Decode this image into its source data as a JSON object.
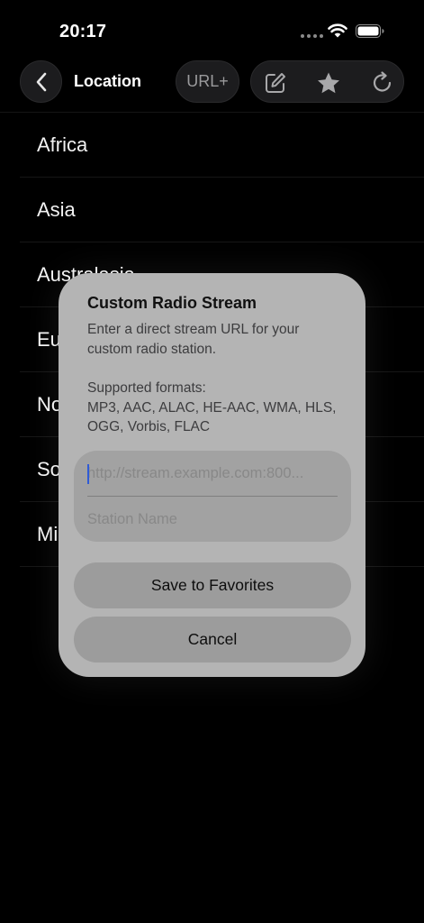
{
  "status_bar": {
    "time": "20:17"
  },
  "nav": {
    "title": "Location",
    "url_button_label": "URL+"
  },
  "regions": [
    "Africa",
    "Asia",
    "Australasia",
    "Europe",
    "North America",
    "South America",
    "Middle East"
  ],
  "dialog": {
    "title": "Custom Radio Stream",
    "message": "Enter a direct stream URL for your custom radio station.",
    "formats_heading": "Supported formats:",
    "formats_list": "MP3, AAC, ALAC, HE-AAC, WMA, HLS, OGG, Vorbis, FLAC",
    "url_placeholder": "http://stream.example.com:800...",
    "url_value": "",
    "name_placeholder": "Station Name",
    "name_value": "",
    "save_label": "Save to Favorites",
    "cancel_label": "Cancel"
  },
  "colors": {
    "background": "#000000",
    "dialog_background": "#b4b4b4",
    "cursor": "#2f5bd6"
  },
  "icons": {
    "back": "chevron-left-icon",
    "edit": "square-pencil-icon",
    "favorite": "star-icon",
    "refresh": "refresh-icon"
  }
}
